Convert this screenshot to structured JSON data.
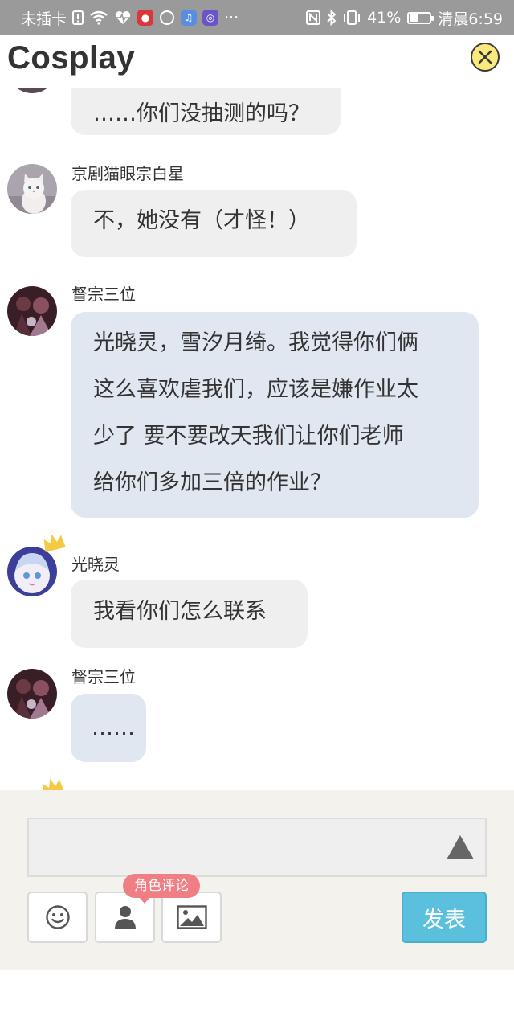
{
  "status_bar": {
    "carrier": "未插卡",
    "more": "···",
    "battery_percent": "41%",
    "battery_level": 0.41,
    "time": "清晨6:59",
    "icons": [
      "sim-alert-icon",
      "wifi-icon",
      "heart-rate-icon",
      "app-icon-red",
      "browser-icon",
      "music-icon",
      "app-icon-purple",
      "nfc-icon",
      "bluetooth-icon",
      "vibrate-icon",
      "battery-icon"
    ]
  },
  "header": {
    "title": "Cosplay",
    "close_icon": "close-icon"
  },
  "messages": [
    {
      "id": 0,
      "name": "",
      "text": "……你们没抽测的吗？",
      "style": "gray"
    },
    {
      "id": 1,
      "name": "京剧猫眼宗白星",
      "text": "不，她没有（才怪！）",
      "style": "gray"
    },
    {
      "id": 2,
      "name": "督宗三位",
      "lines": [
        "光晓灵，雪汐月绮。我觉得你们俩",
        "这么喜欢虐我们，应该是嫌作业太",
        "少了 要不要改天我们让你们老师",
        "给你们多加三倍的作业？"
      ],
      "style": "blue"
    },
    {
      "id": 3,
      "name": "光晓灵",
      "text": "我看你们怎么联系",
      "style": "gray",
      "crown": true
    },
    {
      "id": 4,
      "name": "督宗三位",
      "text": "……",
      "style": "blue"
    }
  ],
  "composer": {
    "input_value": "",
    "send_arrow_icon": "triangle-up-icon",
    "buttons": {
      "emoji_icon": "smiley-icon",
      "role_icon": "person-icon",
      "image_icon": "image-icon"
    },
    "role_tooltip": "角色评论",
    "post_label": "发表"
  },
  "colors": {
    "status_bar": "#9a9a9a",
    "bubble_gray": "#efefef",
    "bubble_blue": "#e1e7f0",
    "post_button": "#5bc0de",
    "tooltip": "#ef7f84",
    "close_button": "#fbe97e"
  }
}
